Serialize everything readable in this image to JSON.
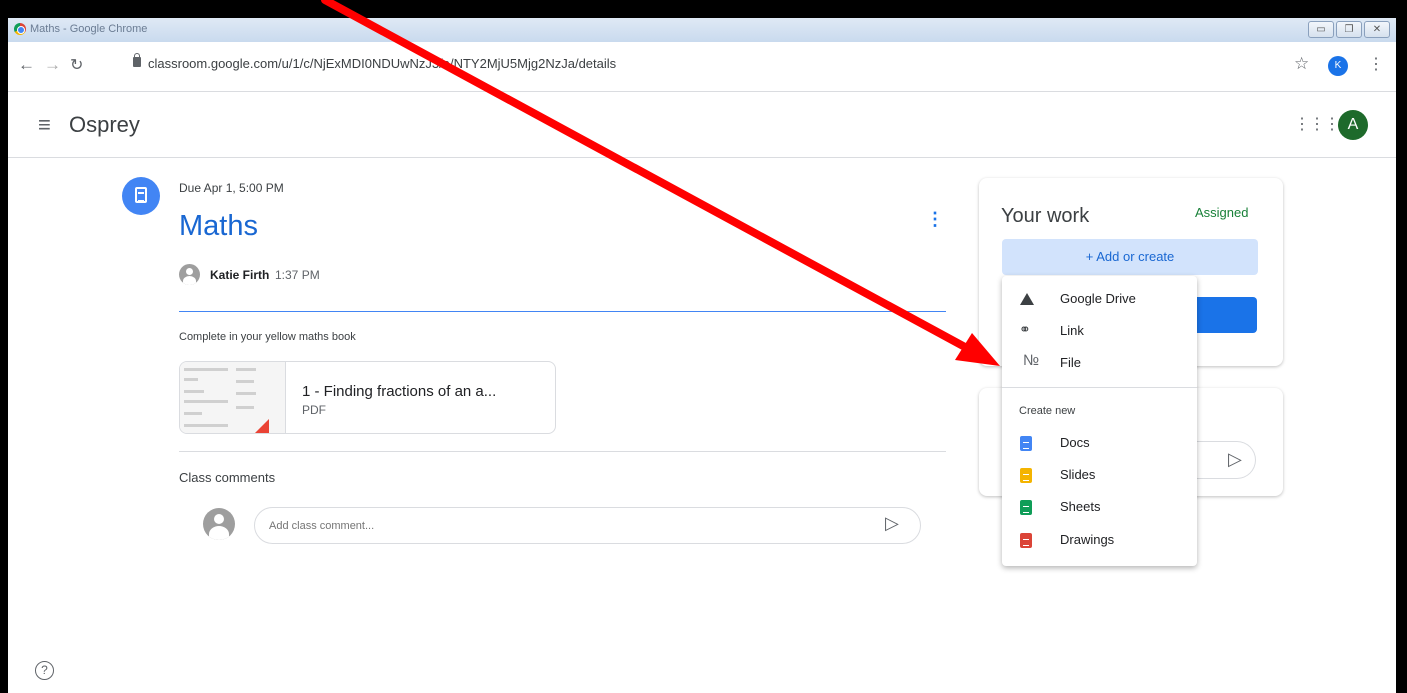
{
  "browser": {
    "window_title": "Maths - Google Chrome",
    "url": "classroom.google.com/u/1/c/NjExMDI0NDUwNzJ3/a/NTY2MjU5Mjg2NzJa/details",
    "profile_initial": "K"
  },
  "header": {
    "class_name": "Osprey",
    "account_initial": "A"
  },
  "assignment": {
    "due": "Due Apr 1, 5:00 PM",
    "title": "Maths",
    "teacher": "Katie Firth",
    "posted_time": "1:37 PM",
    "instructions": "Complete in your yellow maths book",
    "attachment": {
      "name": "1 - Finding fractions of an a...",
      "type": "PDF"
    }
  },
  "comments": {
    "heading": "Class comments",
    "placeholder": "Add class comment..."
  },
  "your_work": {
    "title": "Your work",
    "status": "Assigned",
    "add_button": "+  Add or create"
  },
  "menu": {
    "items": [
      {
        "label": "Google Drive",
        "icon": "google-drive-icon"
      },
      {
        "label": "Link",
        "icon": "link-icon"
      },
      {
        "label": "File",
        "icon": "paperclip-icon"
      }
    ],
    "create_heading": "Create new",
    "create_items": [
      {
        "label": "Docs",
        "icon": "docs-icon",
        "color": "#4285f4"
      },
      {
        "label": "Slides",
        "icon": "slides-icon",
        "color": "#f4b400"
      },
      {
        "label": "Sheets",
        "icon": "sheets-icon",
        "color": "#0f9d58"
      },
      {
        "label": "Drawings",
        "icon": "drawings-icon",
        "color": "#db4437"
      }
    ]
  },
  "colors": {
    "accent": "#1967d2",
    "status_green": "#188038",
    "annotation_arrow": "#ff0000"
  }
}
